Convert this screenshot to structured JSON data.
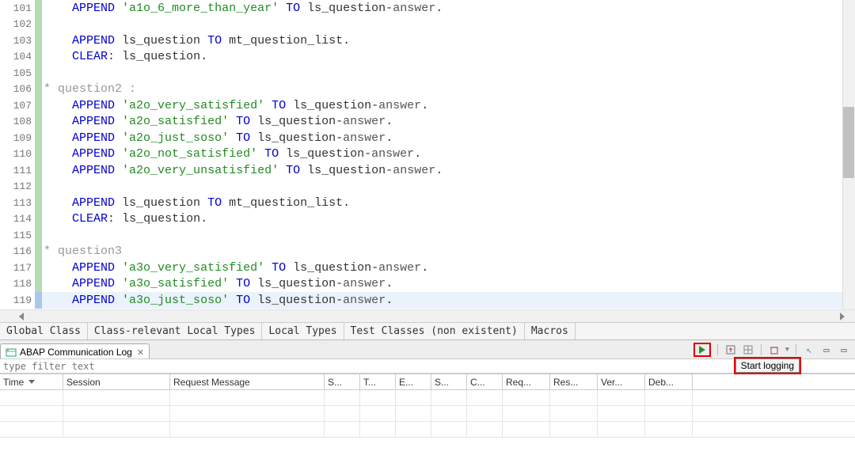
{
  "code": {
    "lines": [
      {
        "num": "101",
        "mark": "green",
        "tokens": [
          {
            "t": "    ",
            "c": ""
          },
          {
            "t": "APPEND",
            "c": "kw"
          },
          {
            "t": " ",
            "c": ""
          },
          {
            "t": "'a1o_6_more_than_year'",
            "c": "str"
          },
          {
            "t": " ",
            "c": ""
          },
          {
            "t": "TO",
            "c": "kw"
          },
          {
            "t": " ",
            "c": ""
          },
          {
            "t": "ls_question",
            "c": "ident"
          },
          {
            "t": "-",
            "c": "op"
          },
          {
            "t": "answer",
            "c": "field"
          },
          {
            "t": ".",
            "c": "dot"
          }
        ]
      },
      {
        "num": "102",
        "mark": "green",
        "tokens": []
      },
      {
        "num": "103",
        "mark": "green",
        "tokens": [
          {
            "t": "    ",
            "c": ""
          },
          {
            "t": "APPEND",
            "c": "kw"
          },
          {
            "t": " ",
            "c": ""
          },
          {
            "t": "ls_question",
            "c": "ident"
          },
          {
            "t": " ",
            "c": ""
          },
          {
            "t": "TO",
            "c": "kw"
          },
          {
            "t": " ",
            "c": ""
          },
          {
            "t": "mt_question_list",
            "c": "ident"
          },
          {
            "t": ".",
            "c": "dot"
          }
        ]
      },
      {
        "num": "104",
        "mark": "green",
        "tokens": [
          {
            "t": "    ",
            "c": ""
          },
          {
            "t": "CLEAR",
            "c": "kw"
          },
          {
            "t": ":",
            "c": "dot"
          },
          {
            "t": " ",
            "c": ""
          },
          {
            "t": "ls_question",
            "c": "ident"
          },
          {
            "t": ".",
            "c": "dot"
          }
        ]
      },
      {
        "num": "105",
        "mark": "green",
        "tokens": []
      },
      {
        "num": "106",
        "mark": "green",
        "tokens": [
          {
            "t": "* question2 :",
            "c": "comment"
          }
        ]
      },
      {
        "num": "107",
        "mark": "green",
        "tokens": [
          {
            "t": "    ",
            "c": ""
          },
          {
            "t": "APPEND",
            "c": "kw"
          },
          {
            "t": " ",
            "c": ""
          },
          {
            "t": "'a2o_very_satisfied'",
            "c": "str"
          },
          {
            "t": " ",
            "c": ""
          },
          {
            "t": "TO",
            "c": "kw"
          },
          {
            "t": " ",
            "c": ""
          },
          {
            "t": "ls_question",
            "c": "ident"
          },
          {
            "t": "-",
            "c": "op"
          },
          {
            "t": "answer",
            "c": "field"
          },
          {
            "t": ".",
            "c": "dot"
          }
        ]
      },
      {
        "num": "108",
        "mark": "green",
        "tokens": [
          {
            "t": "    ",
            "c": ""
          },
          {
            "t": "APPEND",
            "c": "kw"
          },
          {
            "t": " ",
            "c": ""
          },
          {
            "t": "'a2o_satisfied'",
            "c": "str"
          },
          {
            "t": " ",
            "c": ""
          },
          {
            "t": "TO",
            "c": "kw"
          },
          {
            "t": " ",
            "c": ""
          },
          {
            "t": "ls_question",
            "c": "ident"
          },
          {
            "t": "-",
            "c": "op"
          },
          {
            "t": "answer",
            "c": "field"
          },
          {
            "t": ".",
            "c": "dot"
          }
        ]
      },
      {
        "num": "109",
        "mark": "green",
        "tokens": [
          {
            "t": "    ",
            "c": ""
          },
          {
            "t": "APPEND",
            "c": "kw"
          },
          {
            "t": " ",
            "c": ""
          },
          {
            "t": "'a2o_just_soso'",
            "c": "str"
          },
          {
            "t": " ",
            "c": ""
          },
          {
            "t": "TO",
            "c": "kw"
          },
          {
            "t": " ",
            "c": ""
          },
          {
            "t": "ls_question",
            "c": "ident"
          },
          {
            "t": "-",
            "c": "op"
          },
          {
            "t": "answer",
            "c": "field"
          },
          {
            "t": ".",
            "c": "dot"
          }
        ]
      },
      {
        "num": "110",
        "mark": "green",
        "tokens": [
          {
            "t": "    ",
            "c": ""
          },
          {
            "t": "APPEND",
            "c": "kw"
          },
          {
            "t": " ",
            "c": ""
          },
          {
            "t": "'a2o_not_satisfied'",
            "c": "str"
          },
          {
            "t": " ",
            "c": ""
          },
          {
            "t": "TO",
            "c": "kw"
          },
          {
            "t": " ",
            "c": ""
          },
          {
            "t": "ls_question",
            "c": "ident"
          },
          {
            "t": "-",
            "c": "op"
          },
          {
            "t": "answer",
            "c": "field"
          },
          {
            "t": ".",
            "c": "dot"
          }
        ]
      },
      {
        "num": "111",
        "mark": "green",
        "tokens": [
          {
            "t": "    ",
            "c": ""
          },
          {
            "t": "APPEND",
            "c": "kw"
          },
          {
            "t": " ",
            "c": ""
          },
          {
            "t": "'a2o_very_unsatisfied'",
            "c": "str"
          },
          {
            "t": " ",
            "c": ""
          },
          {
            "t": "TO",
            "c": "kw"
          },
          {
            "t": " ",
            "c": ""
          },
          {
            "t": "ls_question",
            "c": "ident"
          },
          {
            "t": "-",
            "c": "op"
          },
          {
            "t": "answer",
            "c": "field"
          },
          {
            "t": ".",
            "c": "dot"
          }
        ]
      },
      {
        "num": "112",
        "mark": "green",
        "tokens": []
      },
      {
        "num": "113",
        "mark": "green",
        "tokens": [
          {
            "t": "    ",
            "c": ""
          },
          {
            "t": "APPEND",
            "c": "kw"
          },
          {
            "t": " ",
            "c": ""
          },
          {
            "t": "ls_question",
            "c": "ident"
          },
          {
            "t": " ",
            "c": ""
          },
          {
            "t": "TO",
            "c": "kw"
          },
          {
            "t": " ",
            "c": ""
          },
          {
            "t": "mt_question_list",
            "c": "ident"
          },
          {
            "t": ".",
            "c": "dot"
          }
        ]
      },
      {
        "num": "114",
        "mark": "green",
        "tokens": [
          {
            "t": "    ",
            "c": ""
          },
          {
            "t": "CLEAR",
            "c": "kw"
          },
          {
            "t": ":",
            "c": "dot"
          },
          {
            "t": " ",
            "c": ""
          },
          {
            "t": "ls_question",
            "c": "ident"
          },
          {
            "t": ".",
            "c": "dot"
          }
        ]
      },
      {
        "num": "115",
        "mark": "green",
        "tokens": []
      },
      {
        "num": "116",
        "mark": "green",
        "tokens": [
          {
            "t": "* question3",
            "c": "comment"
          }
        ]
      },
      {
        "num": "117",
        "mark": "green",
        "tokens": [
          {
            "t": "    ",
            "c": ""
          },
          {
            "t": "APPEND",
            "c": "kw"
          },
          {
            "t": " ",
            "c": ""
          },
          {
            "t": "'a3o_very_satisfied'",
            "c": "str"
          },
          {
            "t": " ",
            "c": ""
          },
          {
            "t": "TO",
            "c": "kw"
          },
          {
            "t": " ",
            "c": ""
          },
          {
            "t": "ls_question",
            "c": "ident"
          },
          {
            "t": "-",
            "c": "op"
          },
          {
            "t": "answer",
            "c": "field"
          },
          {
            "t": ".",
            "c": "dot"
          }
        ]
      },
      {
        "num": "118",
        "mark": "green",
        "tokens": [
          {
            "t": "    ",
            "c": ""
          },
          {
            "t": "APPEND",
            "c": "kw"
          },
          {
            "t": " ",
            "c": ""
          },
          {
            "t": "'a3o_satisfied'",
            "c": "str"
          },
          {
            "t": " ",
            "c": ""
          },
          {
            "t": "TO",
            "c": "kw"
          },
          {
            "t": " ",
            "c": ""
          },
          {
            "t": "ls_question",
            "c": "ident"
          },
          {
            "t": "-",
            "c": "op"
          },
          {
            "t": "answer",
            "c": "field"
          },
          {
            "t": ".",
            "c": "dot"
          }
        ]
      },
      {
        "num": "119",
        "mark": "blue",
        "hl": true,
        "tokens": [
          {
            "t": "    ",
            "c": ""
          },
          {
            "t": "APPEND",
            "c": "kw"
          },
          {
            "t": " ",
            "c": ""
          },
          {
            "t": "'a3o_just_soso'",
            "c": "str"
          },
          {
            "t": " ",
            "c": ""
          },
          {
            "t": "TO",
            "c": "kw"
          },
          {
            "t": " ",
            "c": ""
          },
          {
            "t": "ls_question",
            "c": "ident"
          },
          {
            "t": "-",
            "c": "op"
          },
          {
            "t": "answer",
            "c": "field"
          },
          {
            "t": ".",
            "c": "dot"
          }
        ]
      }
    ]
  },
  "bottom_tabs": [
    "Global Class",
    "Class-relevant Local Types",
    "Local Types",
    "Test Classes (non existent)",
    "Macros"
  ],
  "panel": {
    "title": "ABAP Communication Log",
    "filter_placeholder": "type filter text",
    "start_logging": "Start logging"
  },
  "log_columns": [
    "Time",
    "Session",
    "Request Message",
    "S...",
    "T...",
    "E...",
    "S...",
    "C...",
    "Req...",
    "Res...",
    "Ver...",
    "Deb..."
  ],
  "log_widths": [
    "c-time",
    "c-sess",
    "c-req",
    "c-s1",
    "c-t",
    "c-e",
    "c-s2",
    "c-c",
    "c-rq",
    "c-rs",
    "c-ver",
    "c-deb"
  ]
}
